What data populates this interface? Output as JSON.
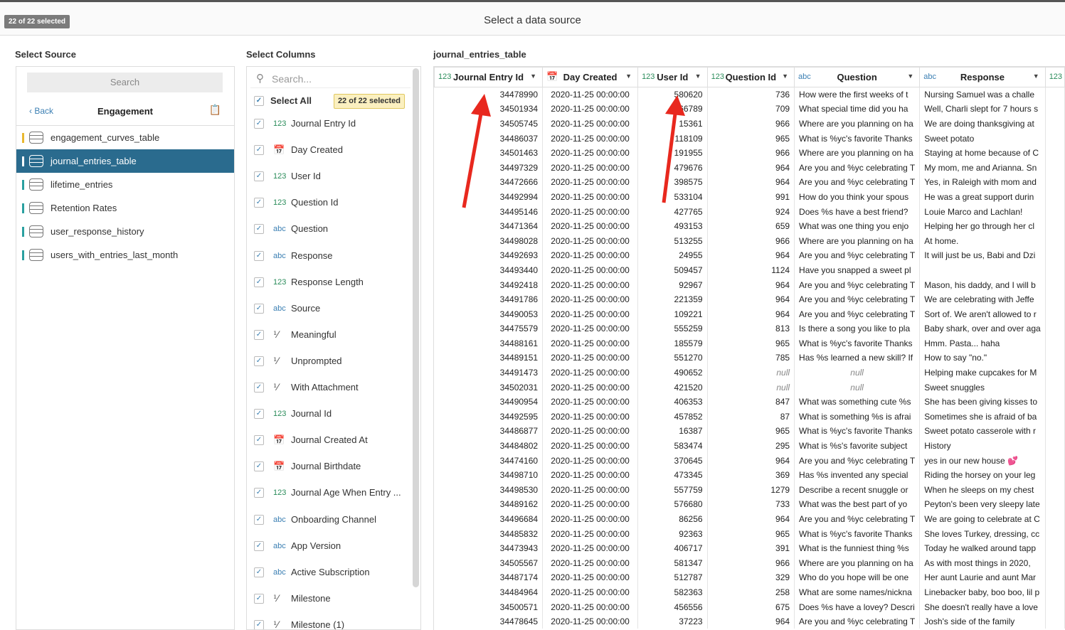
{
  "header": {
    "selected_badge": "22 of 22 selected",
    "title": "Select a data source"
  },
  "source": {
    "section_title": "Select Source",
    "search_placeholder": "Search",
    "back_label": "Back",
    "group_title": "Engagement",
    "items": [
      {
        "label": "engagement_curves_table",
        "active": false
      },
      {
        "label": "journal_entries_table",
        "active": true
      },
      {
        "label": "lifetime_entries",
        "active": false
      },
      {
        "label": "Retention Rates",
        "active": false
      },
      {
        "label": "user_response_history",
        "active": false
      },
      {
        "label": "users_with_entries_last_month",
        "active": false
      }
    ]
  },
  "columns": {
    "section_title": "Select Columns",
    "search_placeholder": "Search...",
    "select_all_label": "Select All",
    "selected_pill": "22 of 22 selected",
    "items": [
      {
        "type": "123",
        "label": "Journal Entry Id"
      },
      {
        "type": "calendar-icon",
        "label": "Day Created"
      },
      {
        "type": "123",
        "label": "User Id"
      },
      {
        "type": "123",
        "label": "Question Id"
      },
      {
        "type": "abc",
        "label": "Question"
      },
      {
        "type": "abc",
        "label": "Response"
      },
      {
        "type": "123",
        "label": "Response Length"
      },
      {
        "type": "abc",
        "label": "Source"
      },
      {
        "type": "boolean-icon",
        "label": "Meaningful"
      },
      {
        "type": "boolean-icon",
        "label": "Unprompted"
      },
      {
        "type": "boolean-icon",
        "label": "With Attachment"
      },
      {
        "type": "123",
        "label": "Journal Id"
      },
      {
        "type": "calendar-icon",
        "label": "Journal Created At"
      },
      {
        "type": "calendar-icon",
        "label": "Journal Birthdate"
      },
      {
        "type": "123",
        "label": "Journal Age When Entry ..."
      },
      {
        "type": "abc",
        "label": "Onboarding Channel"
      },
      {
        "type": "abc",
        "label": "App Version"
      },
      {
        "type": "abc",
        "label": "Active Subscription"
      },
      {
        "type": "boolean-icon",
        "label": "Milestone"
      },
      {
        "type": "boolean-icon",
        "label": "Milestone (1)"
      }
    ]
  },
  "table": {
    "title": "journal_entries_table",
    "headers": [
      {
        "type": "123",
        "label": "Journal Entry Id"
      },
      {
        "type": "calendar-icon",
        "label": "Day Created"
      },
      {
        "type": "123",
        "label": "User Id"
      },
      {
        "type": "123",
        "label": "Question Id"
      },
      {
        "type": "abc",
        "label": "Question"
      },
      {
        "type": "abc",
        "label": "Response"
      },
      {
        "type": "123",
        "label": ""
      }
    ],
    "rows": [
      [
        "34478990",
        "2020-11-25 00:00:00",
        "580620",
        "736",
        "How were the first weeks of t",
        "Nursing Samuel was a challe"
      ],
      [
        "34501934",
        "2020-11-25 00:00:00",
        "566789",
        "709",
        "What special time did you ha",
        "Well, Charli slept for 7 hours s"
      ],
      [
        "34505745",
        "2020-11-25 00:00:00",
        "15361",
        "966",
        "Where are you planning on ha",
        "We are doing thanksgiving at"
      ],
      [
        "34486037",
        "2020-11-25 00:00:00",
        "118109",
        "965",
        "What is %yc's favorite Thanks",
        "Sweet potato"
      ],
      [
        "34501463",
        "2020-11-25 00:00:00",
        "191955",
        "966",
        "Where are you planning on ha",
        "Staying at home because of C"
      ],
      [
        "34497329",
        "2020-11-25 00:00:00",
        "479676",
        "964",
        "Are you and %yc celebrating T",
        "My mom, me and Arianna. Sn"
      ],
      [
        "34472666",
        "2020-11-25 00:00:00",
        "398575",
        "964",
        "Are you and %yc celebrating T",
        "Yes, in Raleigh with mom and"
      ],
      [
        "34492994",
        "2020-11-25 00:00:00",
        "533104",
        "991",
        "How do you think your spous",
        "He was a great support durin"
      ],
      [
        "34495146",
        "2020-11-25 00:00:00",
        "427765",
        "924",
        "Does %s have a best friend?",
        "Louie Marco and Lachlan!"
      ],
      [
        "34471364",
        "2020-11-25 00:00:00",
        "493153",
        "659",
        "What was one thing you enjo",
        "Helping her go through her cl"
      ],
      [
        "34498028",
        "2020-11-25 00:00:00",
        "513255",
        "966",
        "Where are you planning on ha",
        "At home."
      ],
      [
        "34492693",
        "2020-11-25 00:00:00",
        "24955",
        "964",
        "Are you and %yc celebrating T",
        "It will just be us, Babi and Dzi"
      ],
      [
        "34493440",
        "2020-11-25 00:00:00",
        "509457",
        "1124",
        "Have you snapped a sweet pl",
        ""
      ],
      [
        "34492418",
        "2020-11-25 00:00:00",
        "92967",
        "964",
        "Are you and %yc celebrating T",
        "Mason, his daddy, and I will b"
      ],
      [
        "34491786",
        "2020-11-25 00:00:00",
        "221359",
        "964",
        "Are you and %yc celebrating T",
        "We are celebrating with Jeffe"
      ],
      [
        "34490053",
        "2020-11-25 00:00:00",
        "109221",
        "964",
        "Are you and %yc celebrating T",
        "Sort of. We aren't allowed to r"
      ],
      [
        "34475579",
        "2020-11-25 00:00:00",
        "555259",
        "813",
        "Is there a song you like to pla",
        "Baby shark, over and over aga"
      ],
      [
        "34488161",
        "2020-11-25 00:00:00",
        "185579",
        "965",
        "What is %yc's favorite Thanks",
        "Hmm.  Pasta... haha"
      ],
      [
        "34489151",
        "2020-11-25 00:00:00",
        "551270",
        "785",
        "Has %s learned a new skill? If",
        "How to say \"no.\""
      ],
      [
        "34491473",
        "2020-11-25 00:00:00",
        "490652",
        "null",
        "null",
        "Helping make cupcakes for M"
      ],
      [
        "34502031",
        "2020-11-25 00:00:00",
        "421520",
        "null",
        "null",
        "Sweet snuggles"
      ],
      [
        "34490954",
        "2020-11-25 00:00:00",
        "406353",
        "847",
        "What was something cute %s",
        "She has been giving kisses to"
      ],
      [
        "34492595",
        "2020-11-25 00:00:00",
        "457852",
        "87",
        "What is something %s is afrai",
        "Sometimes she is afraid of ba"
      ],
      [
        "34486877",
        "2020-11-25 00:00:00",
        "16387",
        "965",
        "What is %yc's favorite Thanks",
        "Sweet potato casserole with r"
      ],
      [
        "34484802",
        "2020-11-25 00:00:00",
        "583474",
        "295",
        "What is %s's favorite subject",
        "History"
      ],
      [
        "34474160",
        "2020-11-25 00:00:00",
        "370645",
        "964",
        "Are you and %yc celebrating T",
        "yes in our new house 💕"
      ],
      [
        "34498710",
        "2020-11-25 00:00:00",
        "473345",
        "369",
        "Has %s invented any special",
        "Riding the horsey on your leg"
      ],
      [
        "34498530",
        "2020-11-25 00:00:00",
        "557759",
        "1279",
        "Describe a recent snuggle or",
        "When he sleeps on my chest"
      ],
      [
        "34489162",
        "2020-11-25 00:00:00",
        "576680",
        "733",
        "What was the best part of yo",
        "Peyton's been very sleepy late"
      ],
      [
        "34496684",
        "2020-11-25 00:00:00",
        "86256",
        "964",
        "Are you and %yc celebrating T",
        "We are going to celebrate at C"
      ],
      [
        "34485832",
        "2020-11-25 00:00:00",
        "92363",
        "965",
        "What is %yc's favorite Thanks",
        "She loves Turkey, dressing, cc"
      ],
      [
        "34473943",
        "2020-11-25 00:00:00",
        "406717",
        "391",
        "What is the funniest thing %s",
        "Today he walked around tapp"
      ],
      [
        "34505567",
        "2020-11-25 00:00:00",
        "581347",
        "966",
        "Where are you planning on ha",
        "As with most things in 2020,"
      ],
      [
        "34487174",
        "2020-11-25 00:00:00",
        "512787",
        "329",
        "Who do you hope will be one",
        "Her aunt Laurie and aunt Mar"
      ],
      [
        "34484964",
        "2020-11-25 00:00:00",
        "582363",
        "258",
        "What are some names/nickna",
        "Linebacker baby, boo boo, lil p"
      ],
      [
        "34500571",
        "2020-11-25 00:00:00",
        "456556",
        "675",
        "Does %s have a lovey? Descri",
        "She doesn't really have a love"
      ],
      [
        "34478645",
        "2020-11-25 00:00:00",
        "37223",
        "964",
        "Are you and %yc celebrating T",
        "Josh's side of the family"
      ]
    ]
  },
  "colors": {
    "accent": "#2a6b8e",
    "annotation_arrow": "#e8281e"
  }
}
